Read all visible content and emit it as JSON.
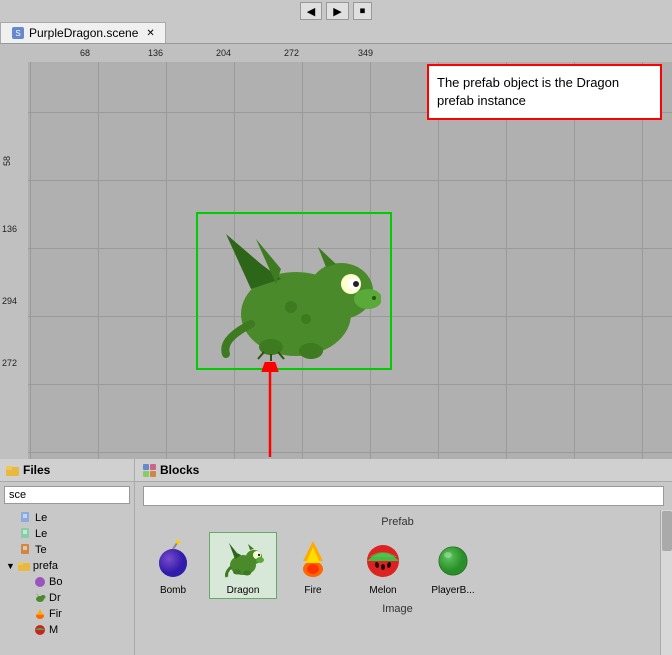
{
  "topbar": {
    "buttons": [
      "◀",
      "▶",
      "⏹"
    ]
  },
  "tab": {
    "label": "PurpleDragon.scene",
    "close": "✕",
    "icon_color": "#6688cc"
  },
  "scene": {
    "ruler_top": [
      "68",
      "136",
      "204",
      "272",
      "349"
    ],
    "ruler_left": [
      "58",
      "136",
      "294",
      "272"
    ],
    "tooltip_text": "The prefab object is the Dragon prefab instance"
  },
  "sidebar": {
    "header": "Files",
    "search_placeholder": "sce",
    "search_value": "sce",
    "items": [
      {
        "label": "Le",
        "type": "file",
        "icon": "file",
        "indent": 1
      },
      {
        "label": "Le",
        "type": "file",
        "icon": "file",
        "indent": 1
      },
      {
        "label": "Te",
        "type": "file",
        "icon": "file",
        "indent": 1
      },
      {
        "label": "prefa",
        "type": "folder",
        "icon": "folder",
        "indent": 1,
        "expanded": true
      },
      {
        "label": "Bo",
        "type": "item",
        "icon": "purple-circle",
        "indent": 2
      },
      {
        "label": "Dr",
        "type": "item",
        "icon": "dragon",
        "indent": 2
      },
      {
        "label": "Fir",
        "type": "item",
        "icon": "fire",
        "indent": 2
      },
      {
        "label": "M",
        "type": "item",
        "icon": "melon",
        "indent": 2
      }
    ]
  },
  "blocks": {
    "header": "Blocks",
    "search_placeholder": "",
    "sections": [
      {
        "label": "Prefab",
        "items": [
          {
            "label": "Bomb",
            "icon": "bomb"
          },
          {
            "label": "Dragon",
            "icon": "dragon"
          },
          {
            "label": "Fire",
            "icon": "fire"
          },
          {
            "label": "Melon",
            "icon": "melon"
          },
          {
            "label": "PlayerB...",
            "icon": "playerball"
          }
        ]
      },
      {
        "label": "Image",
        "items": []
      }
    ]
  }
}
